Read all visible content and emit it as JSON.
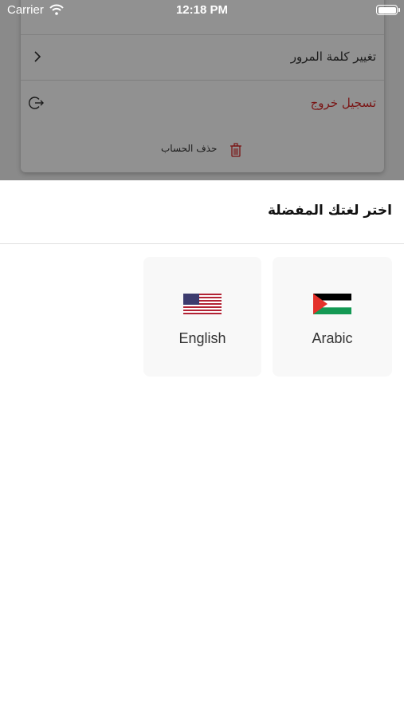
{
  "status_bar": {
    "carrier": "Carrier",
    "time": "12:18 PM",
    "wifi_icon": "wifi-icon",
    "battery_icon": "battery-icon"
  },
  "settings": {
    "change_password_label": "تغيير كلمة المرور",
    "logout_label": "تسجيل خروج",
    "delete_account_label": "حذف الحساب",
    "logout_color": "#7a1414",
    "delete_icon_color": "#b02020"
  },
  "language_sheet": {
    "title": "اختر لغتك المفضلة",
    "options": [
      {
        "label": "Arabic",
        "flag_icon": "palestine-flag-icon"
      },
      {
        "label": "English",
        "flag_icon": "us-flag-icon"
      }
    ]
  }
}
